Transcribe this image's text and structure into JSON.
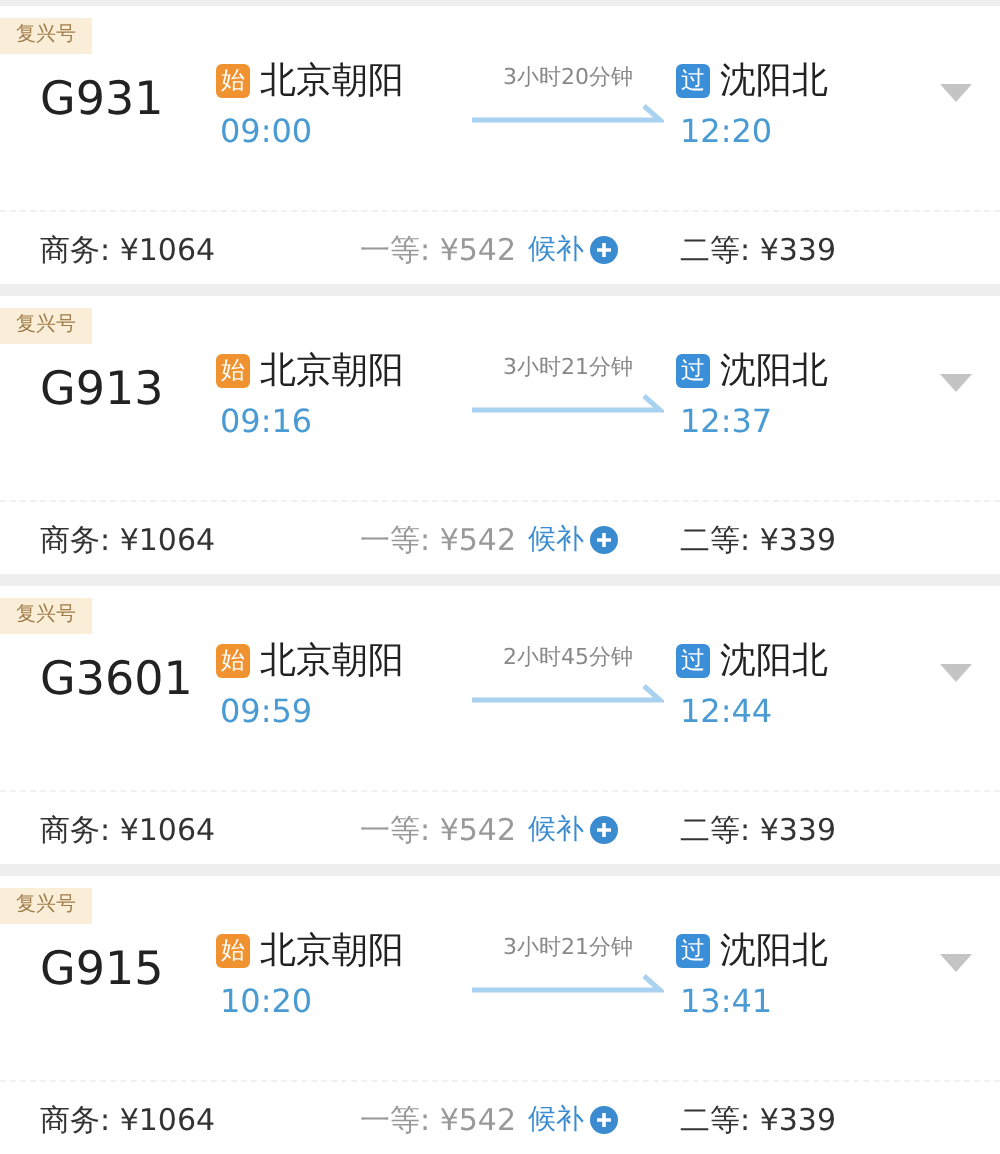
{
  "trains": [
    {
      "class_badge": "复兴号",
      "number": "G931",
      "departure": {
        "tag": "始",
        "station": "北京朝阳",
        "time": "09:00"
      },
      "duration": "3小时20分钟",
      "arrival": {
        "tag": "过",
        "station": "沈阳北",
        "time": "12:20"
      },
      "fares": [
        {
          "label": "商务:",
          "price": "¥1064",
          "available": true
        },
        {
          "label": "一等:",
          "price": "¥542",
          "available": false,
          "waitlist": "候补"
        },
        {
          "label": "二等:",
          "price": "¥339",
          "available": true
        }
      ]
    },
    {
      "class_badge": "复兴号",
      "number": "G913",
      "departure": {
        "tag": "始",
        "station": "北京朝阳",
        "time": "09:16"
      },
      "duration": "3小时21分钟",
      "arrival": {
        "tag": "过",
        "station": "沈阳北",
        "time": "12:37"
      },
      "fares": [
        {
          "label": "商务:",
          "price": "¥1064",
          "available": true
        },
        {
          "label": "一等:",
          "price": "¥542",
          "available": false,
          "waitlist": "候补"
        },
        {
          "label": "二等:",
          "price": "¥339",
          "available": true
        }
      ]
    },
    {
      "class_badge": "复兴号",
      "number": "G3601",
      "departure": {
        "tag": "始",
        "station": "北京朝阳",
        "time": "09:59"
      },
      "duration": "2小时45分钟",
      "arrival": {
        "tag": "过",
        "station": "沈阳北",
        "time": "12:44"
      },
      "fares": [
        {
          "label": "商务:",
          "price": "¥1064",
          "available": true
        },
        {
          "label": "一等:",
          "price": "¥542",
          "available": false,
          "waitlist": "候补"
        },
        {
          "label": "二等:",
          "price": "¥339",
          "available": true
        }
      ]
    },
    {
      "class_badge": "复兴号",
      "number": "G915",
      "departure": {
        "tag": "始",
        "station": "北京朝阳",
        "time": "10:20"
      },
      "duration": "3小时21分钟",
      "arrival": {
        "tag": "过",
        "station": "沈阳北",
        "time": "13:41"
      },
      "fares": [
        {
          "label": "商务:",
          "price": "¥1064",
          "available": true
        },
        {
          "label": "一等:",
          "price": "¥542",
          "available": false,
          "waitlist": "候补"
        },
        {
          "label": "二等:",
          "price": "¥339",
          "available": true
        }
      ]
    }
  ]
}
